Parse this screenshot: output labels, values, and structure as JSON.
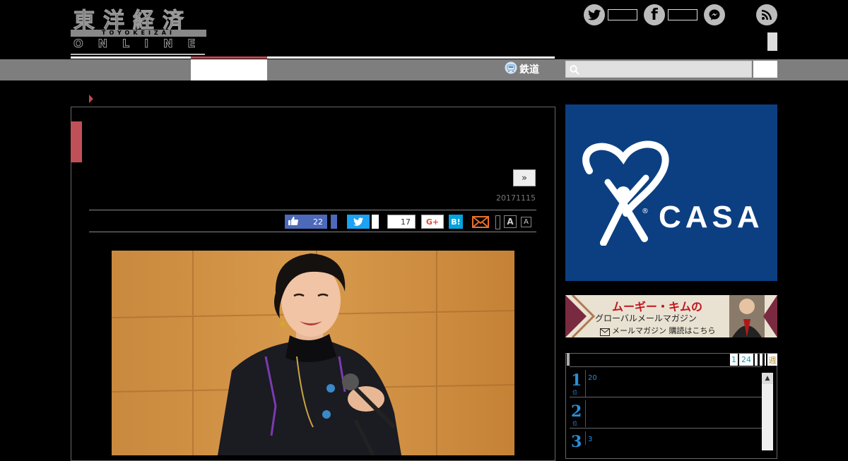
{
  "header": {
    "logo_kanji": "東洋経済",
    "logo_roman": "TOYOKEIZAI",
    "logo_online": "ONLINE",
    "social": [
      {
        "icon": "twitter-icon",
        "glyph": "🐦"
      },
      {
        "icon": "facebook-icon",
        "glyph": "f"
      },
      {
        "icon": "messenger-icon",
        "glyph": "⚡"
      },
      {
        "icon": "rss-icon",
        "glyph": "◉"
      }
    ]
  },
  "nav": {
    "rail_label": "鉄道"
  },
  "article": {
    "next_label": "»",
    "date": "20171115",
    "like_count": "22",
    "hatena_count": "17",
    "gplus_label": "G+",
    "hatena_label": "B!",
    "font_large": "A",
    "font_small": "A"
  },
  "sidebar": {
    "casa_ad": {
      "brand": "CASA",
      "registered": "®"
    },
    "magazine_ad": {
      "title": "ムーギー・キムの",
      "subtitle": "グローバルメールマガジン",
      "cta": "メールマガジン 購読はこちら"
    },
    "ranking": {
      "tabs": [
        "1",
        "24",
        "",
        "",
        "",
        "週"
      ],
      "items": [
        {
          "rank": "1",
          "suffix": "位",
          "text": "20"
        },
        {
          "rank": "2",
          "suffix": "位",
          "text": ""
        },
        {
          "rank": "3",
          "suffix": "位",
          "text": "3"
        }
      ]
    }
  },
  "colors": {
    "accent": "#c04850",
    "nav_gray": "#7e7e7e",
    "casa_blue": "#0b3f82",
    "rank_blue": "#2a8fd8"
  }
}
